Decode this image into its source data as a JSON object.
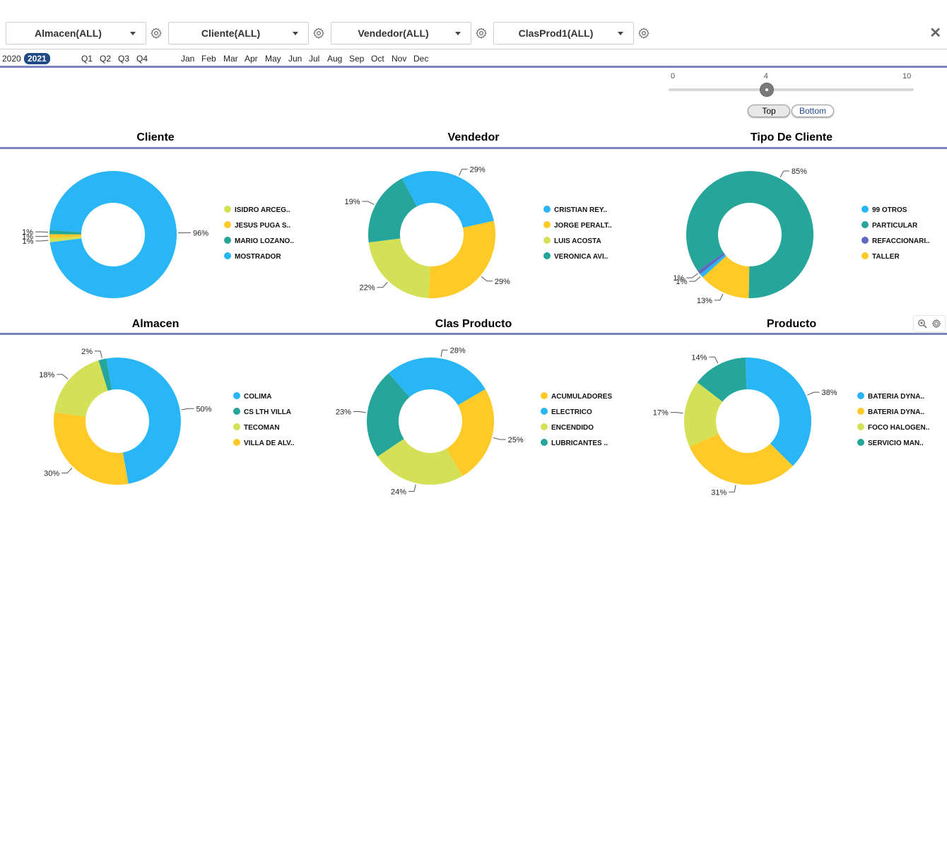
{
  "filters": [
    {
      "label": "Almacen(ALL)"
    },
    {
      "label": "Cliente(ALL)"
    },
    {
      "label": "Vendedor(ALL)"
    },
    {
      "label": "ClasProd1(ALL)"
    }
  ],
  "close_glyph": "✕",
  "periods": {
    "years": [
      "2020",
      "2021"
    ],
    "selected_year": "2021",
    "quarters": [
      "Q1",
      "Q2",
      "Q3",
      "Q4"
    ],
    "months": [
      "Jan",
      "Feb",
      "Mar",
      "Apr",
      "May",
      "Jun",
      "Jul",
      "Aug",
      "Sep",
      "Oct",
      "Nov",
      "Dec"
    ]
  },
  "slider": {
    "min": 0,
    "max": 10,
    "value": 4,
    "min_label": "0",
    "value_label": "4",
    "max_label": "10"
  },
  "toggle": {
    "top_label": "Top",
    "bottom_label": "Bottom",
    "selected": "Top"
  },
  "colors": {
    "blue": "#29b6f6",
    "yellow": "#ffca28",
    "lime": "#d4e157",
    "teal": "#26a69a",
    "indigo": "#5c6bc0",
    "accent": "#1e4a86",
    "separator": "#7b84c0"
  },
  "icons": {
    "gear": "gear-icon",
    "zoom": "zoom-icon",
    "settings": "settings-icon",
    "close": "close-icon"
  },
  "chart_data": [
    {
      "type": "pie",
      "title": "Cliente",
      "slices": [
        {
          "label": "MOSTRADOR",
          "value": 96,
          "pct_label": "96%",
          "color": "#29b6f6"
        },
        {
          "label": "ISIDRO ARCEG..",
          "value": 1,
          "pct_label": "1%",
          "color": "#d4e157"
        },
        {
          "label": "JESUS PUGA S..",
          "value": 1,
          "pct_label": "1%",
          "color": "#ffca28"
        },
        {
          "label": "MARIO LOZANO..",
          "value": 1,
          "pct_label": "1%",
          "color": "#26a69a"
        }
      ],
      "legend": [
        {
          "label": "ISIDRO ARCEG..",
          "color": "#d4e157"
        },
        {
          "label": "JESUS PUGA S..",
          "color": "#ffca28"
        },
        {
          "label": "MARIO LOZANO..",
          "color": "#26a69a"
        },
        {
          "label": "MOSTRADOR",
          "color": "#29b6f6"
        }
      ]
    },
    {
      "type": "pie",
      "title": "Vendedor",
      "slices": [
        {
          "label": "CRISTIAN REY..",
          "value": 29,
          "pct_label": "29%",
          "color": "#29b6f6"
        },
        {
          "label": "JORGE PERALT..",
          "value": 29,
          "pct_label": "29%",
          "color": "#ffca28"
        },
        {
          "label": "LUIS ACOSTA",
          "value": 22,
          "pct_label": "22%",
          "color": "#d4e157"
        },
        {
          "label": "VERONICA AVI..",
          "value": 19,
          "pct_label": "19%",
          "color": "#26a69a"
        }
      ],
      "legend": [
        {
          "label": "CRISTIAN REY..",
          "color": "#29b6f6"
        },
        {
          "label": "JORGE PERALT..",
          "color": "#ffca28"
        },
        {
          "label": "LUIS ACOSTA",
          "color": "#d4e157"
        },
        {
          "label": "VERONICA AVI..",
          "color": "#26a69a"
        }
      ]
    },
    {
      "type": "pie",
      "title": "Tipo De Cliente",
      "slices": [
        {
          "label": "PARTICULAR",
          "value": 85,
          "pct_label": "85%",
          "color": "#26a69a"
        },
        {
          "label": "TALLER",
          "value": 13,
          "pct_label": "13%",
          "color": "#ffca28"
        },
        {
          "label": "99 OTROS",
          "value": 1,
          "pct_label": "1%",
          "color": "#29b6f6"
        },
        {
          "label": "REFACCIONARI..",
          "value": 1,
          "pct_label": "1%",
          "color": "#5c6bc0"
        }
      ],
      "legend": [
        {
          "label": "99 OTROS",
          "color": "#29b6f6"
        },
        {
          "label": "PARTICULAR",
          "color": "#26a69a"
        },
        {
          "label": "REFACCIONARI..",
          "color": "#5c6bc0"
        },
        {
          "label": "TALLER",
          "color": "#ffca28"
        }
      ]
    },
    {
      "type": "pie",
      "title": "Almacen",
      "slices": [
        {
          "label": "COLIMA",
          "value": 50,
          "pct_label": "50%",
          "color": "#29b6f6"
        },
        {
          "label": "VILLA DE ALV..",
          "value": 30,
          "pct_label": "30%",
          "color": "#ffca28"
        },
        {
          "label": "TECOMAN",
          "value": 18,
          "pct_label": "18%",
          "color": "#d4e157"
        },
        {
          "label": "CS LTH VILLA",
          "value": 2,
          "pct_label": "2%",
          "color": "#26a69a"
        }
      ],
      "legend": [
        {
          "label": "COLIMA",
          "color": "#29b6f6"
        },
        {
          "label": "CS LTH VILLA",
          "color": "#26a69a"
        },
        {
          "label": "TECOMAN",
          "color": "#d4e157"
        },
        {
          "label": "VILLA DE ALV..",
          "color": "#ffca28"
        }
      ]
    },
    {
      "type": "pie",
      "title": "Clas Producto",
      "slices": [
        {
          "label": "ELECTRICO",
          "value": 28,
          "pct_label": "28%",
          "color": "#29b6f6"
        },
        {
          "label": "ACUMULADORES",
          "value": 25,
          "pct_label": "25%",
          "color": "#ffca28"
        },
        {
          "label": "ENCENDIDO",
          "value": 24,
          "pct_label": "24%",
          "color": "#d4e157"
        },
        {
          "label": "LUBRICANTES ..",
          "value": 23,
          "pct_label": "23%",
          "color": "#26a69a"
        }
      ],
      "legend": [
        {
          "label": "ACUMULADORES",
          "color": "#ffca28"
        },
        {
          "label": "ELECTRICO",
          "color": "#29b6f6"
        },
        {
          "label": "ENCENDIDO",
          "color": "#d4e157"
        },
        {
          "label": "LUBRICANTES ..",
          "color": "#26a69a"
        }
      ]
    },
    {
      "type": "pie",
      "title": "Producto",
      "slices": [
        {
          "label": "BATERIA DYNA..",
          "value": 38,
          "pct_label": "38%",
          "color": "#29b6f6"
        },
        {
          "label": "BATERIA DYNA..",
          "value": 31,
          "pct_label": "31%",
          "color": "#ffca28"
        },
        {
          "label": "FOCO HALOGEN..",
          "value": 17,
          "pct_label": "17%",
          "color": "#d4e157"
        },
        {
          "label": "SERVICIO MAN..",
          "value": 14,
          "pct_label": "14%",
          "color": "#26a69a"
        }
      ],
      "legend": [
        {
          "label": "BATERIA DYNA..",
          "color": "#29b6f6"
        },
        {
          "label": "BATERIA DYNA..",
          "color": "#ffca28"
        },
        {
          "label": "FOCO HALOGEN..",
          "color": "#d4e157"
        },
        {
          "label": "SERVICIO MAN..",
          "color": "#26a69a"
        }
      ]
    }
  ]
}
